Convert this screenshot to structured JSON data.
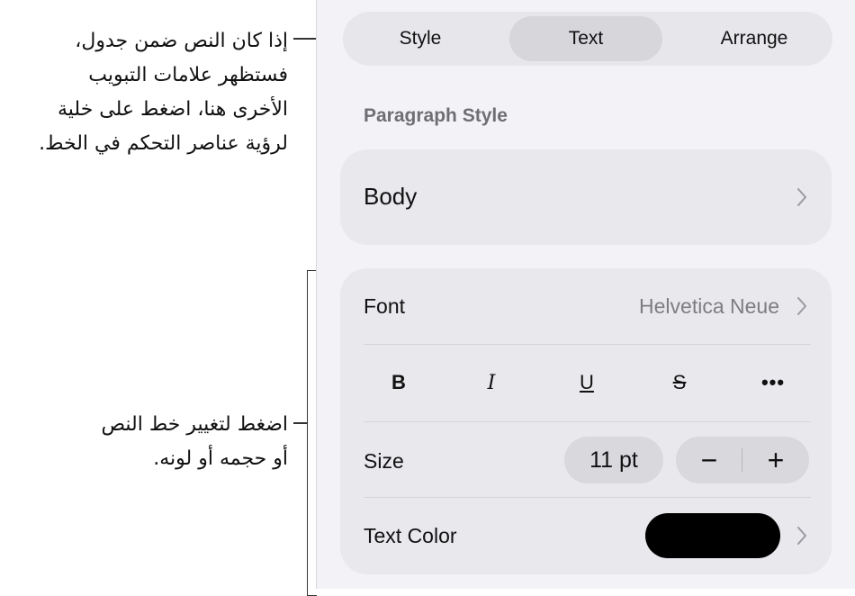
{
  "callouts": {
    "top": "إذا كان النص ضمن جدول،\nفستظهر علامات التبويب\nالأخرى هنا، اضغط على خلية\nلرؤية عناصر التحكم في الخط.",
    "bottom": "اضغط لتغيير خط النص\nأو حجمه أو لونه."
  },
  "tabs": [
    {
      "label": "Style"
    },
    {
      "label": "Text",
      "active": true
    },
    {
      "label": "Arrange"
    }
  ],
  "paragraph": {
    "section_label": "Paragraph Style",
    "value": "Body"
  },
  "font_card": {
    "font_label": "Font",
    "font_value": "Helvetica Neue",
    "format_buttons": {
      "bold": "B",
      "italic": "I",
      "underline": "U",
      "strikethrough": "S",
      "more": "•••"
    },
    "size_label": "Size",
    "size_value": "11 pt",
    "decrement": "−",
    "increment": "+",
    "color_label": "Text Color",
    "color_value": "#000000"
  },
  "colors": {
    "panel_bg": "#f2f2f7",
    "card_bg": "#e8e8ed",
    "secondary_text": "#7d7d82"
  }
}
